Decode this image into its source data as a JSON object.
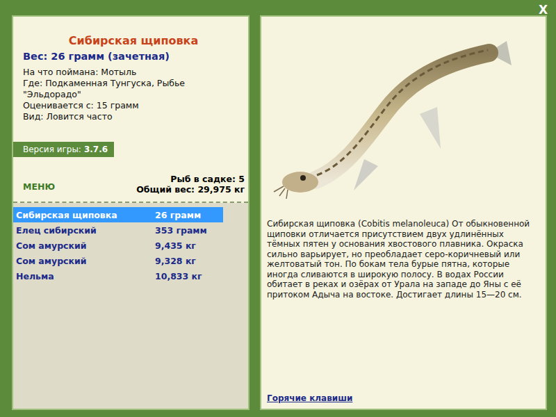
{
  "title": "Сибирская щиповка",
  "weight": "Вес: 26 грамм (зачетная)",
  "info": [
    "На что поймана: Мотыль",
    "Где: Подкаменная Тунгуска, Рыбье \"Эльдорадо\"",
    "Оценивается с: 15 грамм",
    "Вид: Ловится часто"
  ],
  "version": {
    "label": "Версия игры:",
    "value": "3.7.6"
  },
  "menu": "МЕНЮ",
  "keepnet": {
    "count": "Рыб в садке: 5",
    "total": "Общий вес: 29,975 кг"
  },
  "catch": [
    {
      "name": "Сибирская щиповка",
      "weight": "26 грамм",
      "selected": true
    },
    {
      "name": "Елец сибирский",
      "weight": "353 грамм",
      "selected": false
    },
    {
      "name": "Сом амурский",
      "weight": "9,435 кг",
      "selected": false
    },
    {
      "name": "Сом амурский",
      "weight": "9,328 кг",
      "selected": false
    },
    {
      "name": "Нельма",
      "weight": "10,833 кг",
      "selected": false
    }
  ],
  "description": "Сибирская щиповка (Cobitis melanoleuca) От обыкновенной щиповки отличается присутствием двух удлинённых тёмных пятен у основания хвостового плавника. Окраска сильно варьирует, но преобладает серо-коричневый или желтоватый тон. По бокам тела бурые пятна, которые иногда сливаются в широкую полосу. В водах России обитает в реках и озёрах от Урала на западе до Яны с её притоком Адыча на востоке. Достигает длины 15—20 см.",
  "hotkeys": "Горячие клавиши",
  "close": "X"
}
